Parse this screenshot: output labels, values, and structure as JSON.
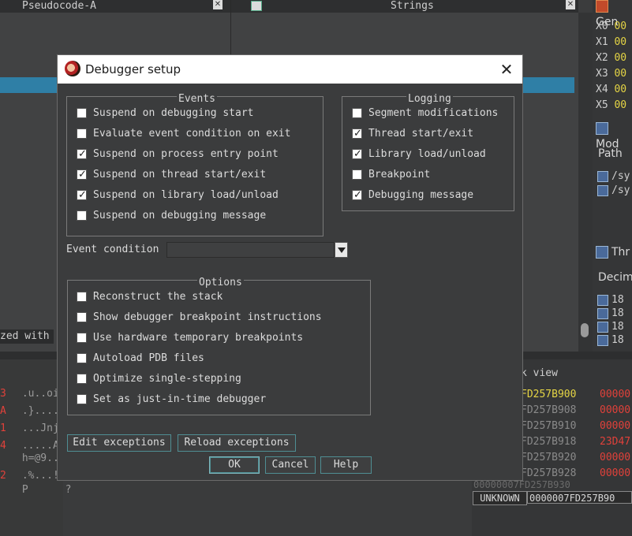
{
  "background": {
    "tab_pseudocode": "Pseudocode-A",
    "tab_strings": "Strings",
    "tab_strings_icon": "strings-window-icon",
    "status_text": "zed with",
    "hex_rows": [
      {
        "mark": "3",
        "text": " .u..oi"
      },
      {
        "mark": "A",
        "text": " .}...."
      },
      {
        "mark": "1",
        "text": " ...Jnj"
      },
      {
        "mark": "4",
        "text": " .....A"
      },
      {
        "mark": "",
        "text": " h=@9.."
      },
      {
        "mark": "2",
        "text": " .%...!"
      },
      {
        "mark": "",
        "text": " P      ?"
      }
    ],
    "stack_view_title": "k view",
    "stack_rows": [
      {
        "addr": "FD257B900",
        "val": "00000"
      },
      {
        "addr": "FD257B908",
        "val": "00000"
      },
      {
        "addr": "FD257B910",
        "val": "00000"
      },
      {
        "addr": "FD257B918",
        "val": "23D47"
      },
      {
        "addr": "FD257B920",
        "val": "00000"
      },
      {
        "addr": "FD257B928",
        "val": "00000"
      }
    ],
    "stack_cut_row": "00000007FD257B930",
    "segment_label": "UNKNOWN",
    "segment_addr": "0000007FD257B90",
    "right_header_top": "Gen",
    "registers": [
      {
        "name": "X0",
        "value": "00"
      },
      {
        "name": "X1",
        "value": "00"
      },
      {
        "name": "X2",
        "value": "00"
      },
      {
        "name": "X3",
        "value": "00"
      },
      {
        "name": "X4",
        "value": "00"
      },
      {
        "name": "X5",
        "value": "00"
      }
    ],
    "modules_header": "Mod",
    "modules_col": "Path",
    "modules_rows": [
      "/sy",
      "/sy"
    ],
    "threads_header": "Thr",
    "threads_col": "Decim",
    "threads_rows": [
      "18",
      "18",
      "18",
      "18"
    ]
  },
  "dialog": {
    "title": "Debugger setup",
    "events_group": {
      "title": "Events",
      "items": [
        {
          "label": "Suspend on debugging start",
          "checked": false
        },
        {
          "label": "Evaluate event condition on exit",
          "checked": false
        },
        {
          "label": "Suspend on process entry point",
          "checked": true
        },
        {
          "label": "Suspend on thread start/exit",
          "checked": true
        },
        {
          "label": "Suspend on library load/unload",
          "checked": true
        },
        {
          "label": "Suspend on debugging message",
          "checked": false
        }
      ]
    },
    "logging_group": {
      "title": "Logging",
      "items": [
        {
          "label": "Segment modifications",
          "checked": false
        },
        {
          "label": "Thread start/exit",
          "checked": true
        },
        {
          "label": "Library load/unload",
          "checked": true
        },
        {
          "label": "Breakpoint",
          "checked": false
        },
        {
          "label": "Debugging message",
          "checked": true
        }
      ]
    },
    "event_condition": {
      "label": "Event condition",
      "value": ""
    },
    "options_group": {
      "title": "Options",
      "items": [
        {
          "label": "Reconstruct the stack",
          "checked": false
        },
        {
          "label": "Show debugger breakpoint instructions",
          "checked": false
        },
        {
          "label": "Use hardware temporary breakpoints",
          "checked": false
        },
        {
          "label": "Autoload PDB files",
          "checked": false
        },
        {
          "label": "Optimize single-stepping",
          "checked": false
        },
        {
          "label": "Set as just-in-time debugger",
          "checked": false
        }
      ]
    },
    "buttons": {
      "edit_exceptions": "Edit exceptions",
      "reload_exceptions": "Reload exceptions",
      "ok": "OK",
      "cancel": "Cancel",
      "help": "Help"
    }
  }
}
